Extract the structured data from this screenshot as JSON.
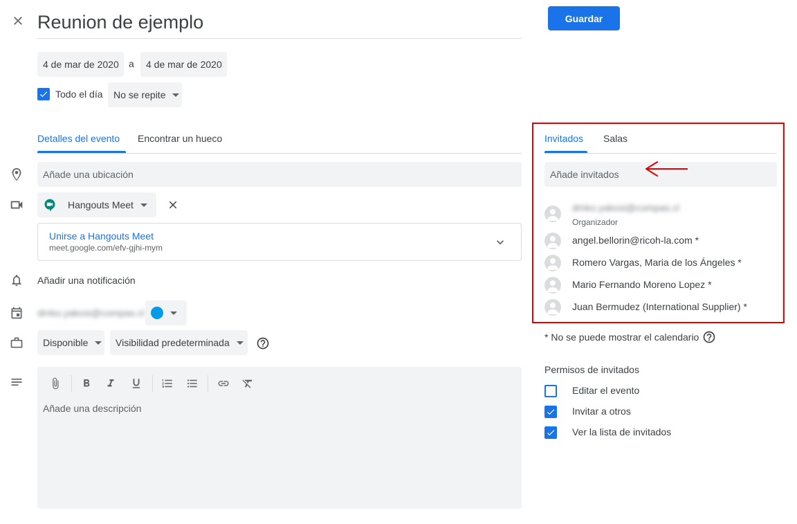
{
  "header": {
    "title": "Reunion de ejemplo",
    "save_label": "Guardar"
  },
  "dates": {
    "start": "4 de mar de 2020",
    "separator": "a",
    "end": "4 de mar de 2020"
  },
  "all_day": {
    "label": "Todo el día",
    "checked": true
  },
  "repeat": {
    "value": "No se repite"
  },
  "left_tabs": {
    "details": "Detalles del evento",
    "find_slot": "Encontrar un hueco"
  },
  "location": {
    "placeholder": "Añade una ubicación"
  },
  "conference": {
    "provider": "Hangouts Meet",
    "join_label": "Unirse a Hangouts Meet",
    "url": "meet.google.com/efv-gjhi-mym"
  },
  "notification": {
    "label": "Añadir una notificación"
  },
  "calendar": {
    "owner": "dmko.yakosi@compas.cl",
    "color": "#039be5"
  },
  "availability": {
    "value": "Disponible"
  },
  "visibility": {
    "value": "Visibilidad predeterminada"
  },
  "description": {
    "placeholder": "Añade una descripción"
  },
  "toolbar_icons": [
    "attach-icon",
    "bold-icon",
    "italic-icon",
    "underline-icon",
    "numbered-list-icon",
    "bulleted-list-icon",
    "link-icon",
    "clear-format-icon"
  ],
  "right_tabs": {
    "guests": "Invitados",
    "rooms": "Salas"
  },
  "guests_input": {
    "placeholder": "Añade invitados"
  },
  "guests": [
    {
      "name": "dmko.yakosi@compas.cl",
      "role": "Organizador"
    },
    {
      "name": "angel.bellorin@ricoh-la.com *"
    },
    {
      "name": "Romero Vargas, Maria de los Ángeles *"
    },
    {
      "name": "Mario Fernando Moreno Lopez *"
    },
    {
      "name": "Juan Bermudez (International Supplier) *"
    }
  ],
  "footnote": "* No se puede mostrar el calendario",
  "permissions": {
    "title": "Permisos de invitados",
    "items": [
      {
        "label": "Editar el evento",
        "checked": false
      },
      {
        "label": "Invitar a otros",
        "checked": true
      },
      {
        "label": "Ver la lista de invitados",
        "checked": true
      }
    ]
  },
  "colors": {
    "accent": "#1a73e8",
    "annotation_red": "#e50000"
  }
}
